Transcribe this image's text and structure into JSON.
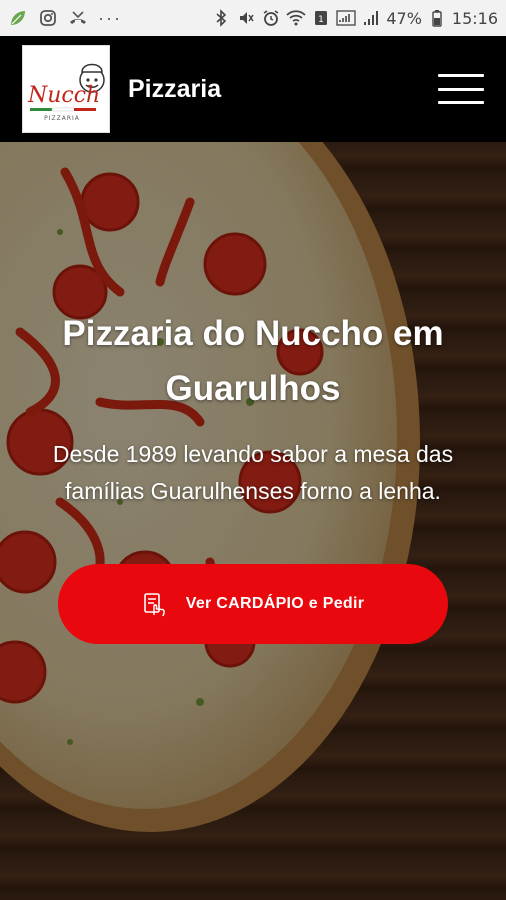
{
  "status_bar": {
    "icons_left": [
      "leaf-icon",
      "instagram-icon",
      "missed-call-icon",
      "more-dots-icon"
    ],
    "more_dots": "···",
    "battery": "47%",
    "time": "15:16"
  },
  "header": {
    "logo_text": "Nucch",
    "logo_subtext": "PIZZARIA",
    "title": "Pizzaria"
  },
  "hero": {
    "title": "Pizzaria do Nuccho em Guarulhos",
    "subtitle": "Desde 1989 levando sabor a mesa das famílias Guarulhenses forno a lenha.",
    "cta_label": "Ver CARDÁPIO e Pedir"
  },
  "colors": {
    "header_bg": "#000000",
    "cta_bg": "#e8080d",
    "status_bg": "#f2f2f2"
  }
}
